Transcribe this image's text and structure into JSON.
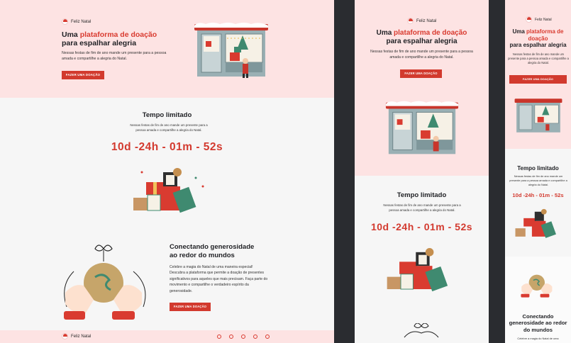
{
  "brand": {
    "name": "Feliz Natal"
  },
  "hero": {
    "title_pre": "Uma ",
    "title_accent": "plataforma de doação",
    "title_post": "para espalhar alegria",
    "text": "Nessas festas de fim de ano mande um presente para a pessoa amada e compartilhe a alegria do Natal.",
    "button": "FAZER UMA DOAÇÃO"
  },
  "countdown_section": {
    "title": "Tempo limitado",
    "text": "Nessas festas de fim de ano mande um presente para a pessoa amada e compartilhe a alegria do Natal.",
    "countdown": "10d -24h - 01m - 52s"
  },
  "generosity_section": {
    "title": "Conectando generosidade ao redor do mundos",
    "text": "Celebre a magia do Natal de uma maneira especial! Descubra a plataforma que permite a doação de presentes significativos para aqueles que mais precisam. Faça parte do movimento e compartilhe o verdadeiro espírito da generosidade.",
    "text_short": "Celebre a magia do Natal de uma",
    "button": "FAZER UMA DOAÇÃO"
  },
  "footer": {
    "brand": "Feliz Natal",
    "social_icons": [
      "pinterest-icon",
      "whatsapp-icon",
      "instagram-icon",
      "messenger-icon",
      "email-icon"
    ]
  },
  "colors": {
    "accent": "#d93b30",
    "hero_bg": "#fde3e3",
    "page_bg": "#f6f6f6",
    "shop": "#8fa7ac"
  }
}
